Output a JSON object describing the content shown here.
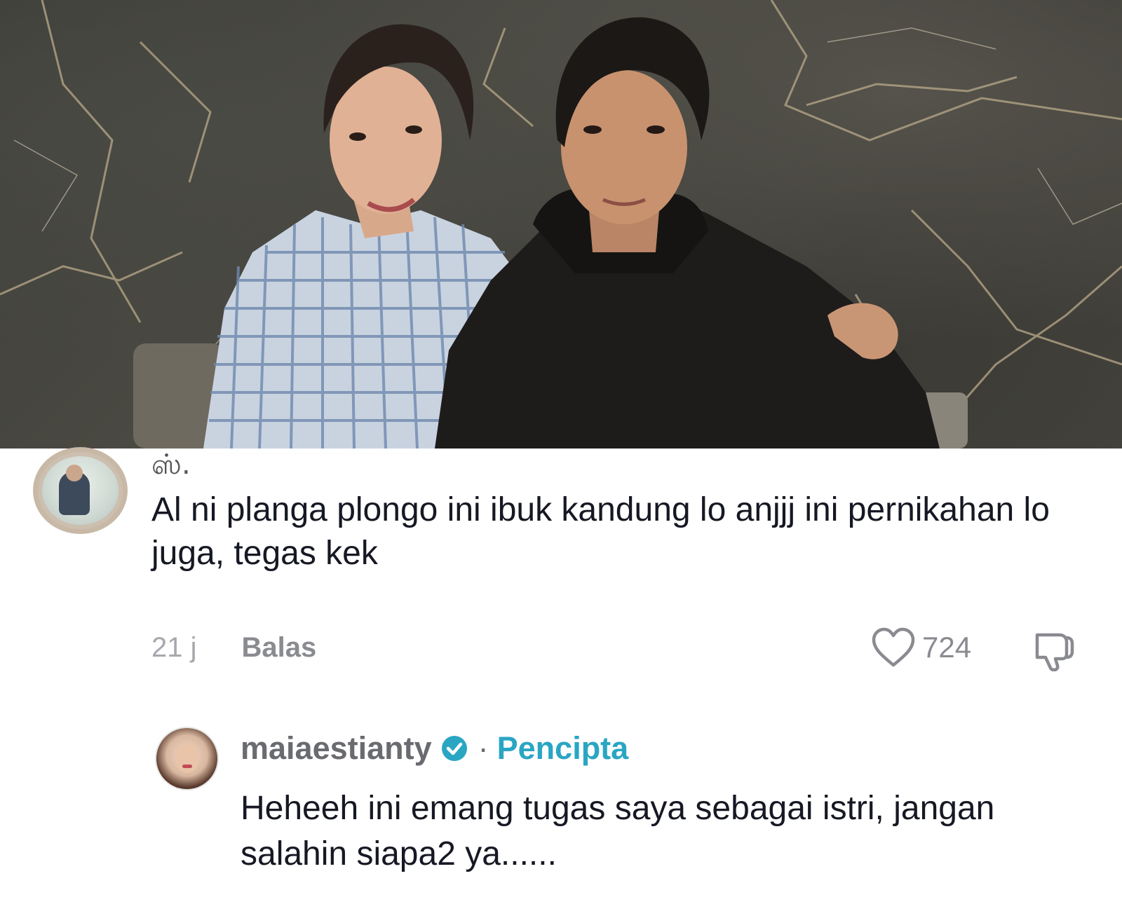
{
  "post": {
    "photo_alt": "photo"
  },
  "comment": {
    "username": "ஸ்.",
    "text": "Al ni planga plongo ini ibuk kandung lo anjjj ini pernikahan lo juga, tegas kek",
    "time": "21 j",
    "reply_label": "Balas",
    "like_count": "724",
    "icons": {
      "like": "heart-outline-icon",
      "dislike": "thumbs-down-icon"
    }
  },
  "reply": {
    "username": "maiaestianty",
    "separator": "·",
    "badge": "Pencipta",
    "text": "Heheeh ini emang tugas saya sebagai istri, jangan salahin siapa2 ya......",
    "icons": {
      "verified": "verified-check-icon"
    }
  },
  "colors": {
    "creator_badge": "#2aa6c3",
    "verified": "#2aa6c3",
    "secondary_text": "#8a8b91",
    "primary_text": "#161823"
  }
}
